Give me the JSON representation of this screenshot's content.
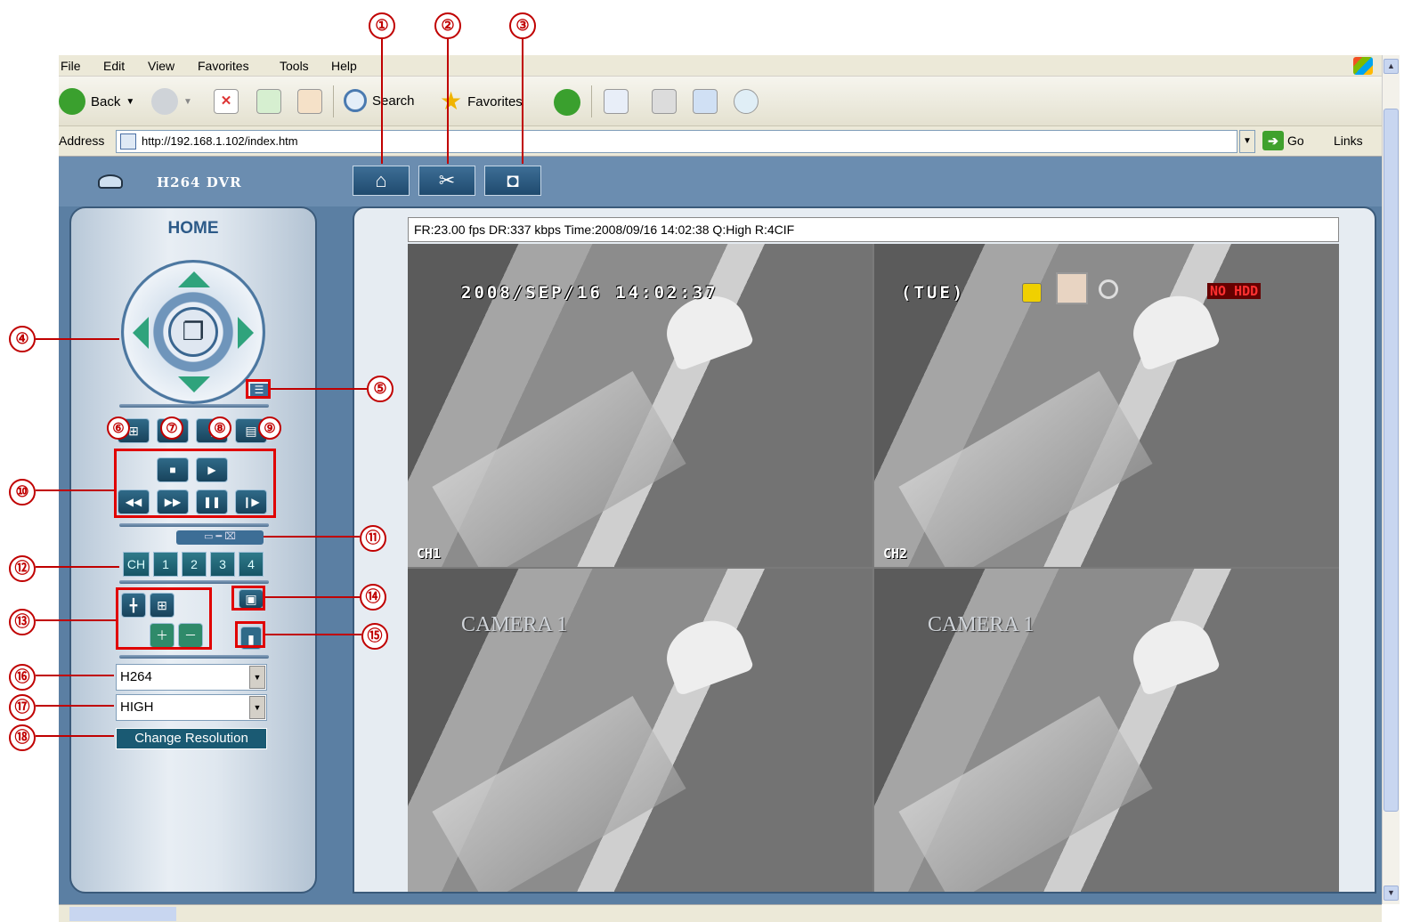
{
  "browser": {
    "menu": [
      "File",
      "Edit",
      "View",
      "Favorites",
      "Tools",
      "Help"
    ],
    "toolbar": {
      "back": "Back",
      "search": "Search",
      "favorites": "Favorites"
    },
    "address_label": "Address",
    "address_value": "http://192.168.1.102/index.htm",
    "go": "Go",
    "links": "Links"
  },
  "app": {
    "title": "H264 DVR",
    "nav": [
      {
        "icon": "home-icon",
        "glyph": "⌂"
      },
      {
        "icon": "tools-icon",
        "glyph": "✂"
      },
      {
        "icon": "camera-icon",
        "glyph": "◘"
      }
    ]
  },
  "panel": {
    "title": "HOME",
    "channels": [
      "CH",
      "1",
      "2",
      "3",
      "4"
    ],
    "codec_select": "H264",
    "quality_select": "HIGH",
    "change_resolution": "Change Resolution"
  },
  "viewer": {
    "status": "FR:23.00 fps  DR:337 kbps Time:2008/09/16 14:02:38 Q:High R:4CIF",
    "osd_datetime": "2008/SEP/16   14:02:37",
    "osd_day": "(TUE)",
    "osd_hdd": "NO HDD",
    "quads": [
      {
        "label": "CH1",
        "camera": ""
      },
      {
        "label": "CH2",
        "camera": ""
      },
      {
        "label": "",
        "camera": "CAMERA 1"
      },
      {
        "label": "",
        "camera": "CAMERA 1"
      }
    ]
  },
  "callouts": [
    "①",
    "②",
    "③",
    "④",
    "⑤",
    "⑥",
    "⑦",
    "⑧",
    "⑨",
    "⑩",
    "⑪",
    "⑫",
    "⑬",
    "⑭",
    "⑮",
    "⑯",
    "⑰",
    "⑱"
  ],
  "colors": {
    "app_bg": "#5b7fa3",
    "accent": "#2fa37c",
    "callout": "#c00000"
  }
}
